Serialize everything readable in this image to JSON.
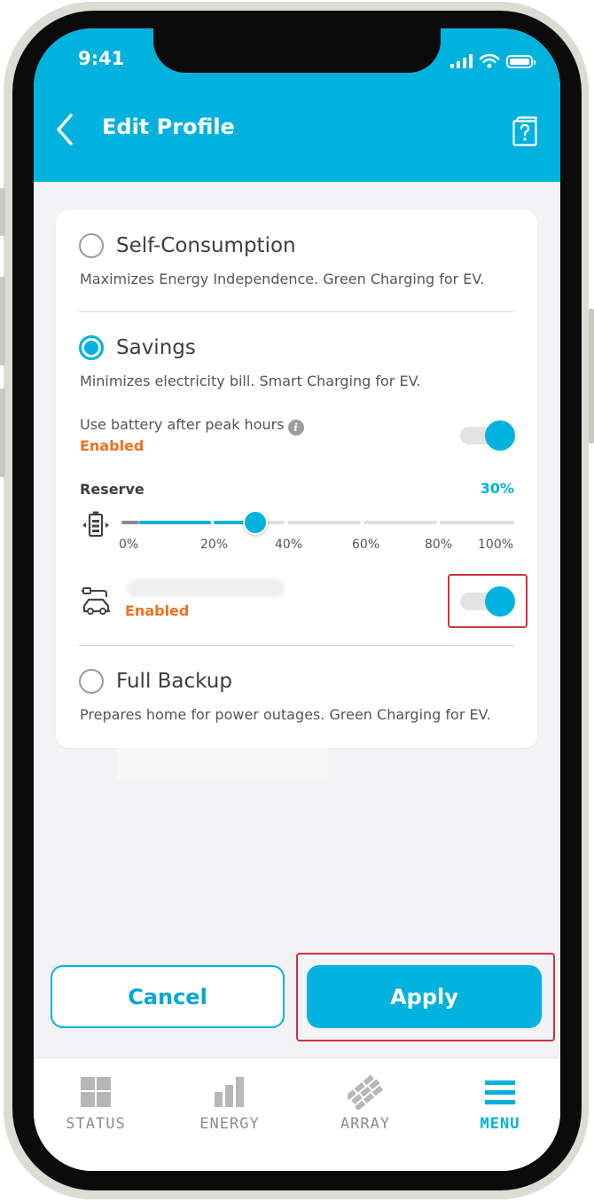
{
  "status_bar": {
    "time": "9:41"
  },
  "header": {
    "title": "Edit Profile"
  },
  "profiles": [
    {
      "title": "Self-Consumption",
      "description": "Maximizes Energy Independence. Green Charging for EV.",
      "selected": false
    },
    {
      "title": "Savings",
      "description": "Minimizes electricity bill. Smart Charging for EV.",
      "selected": true
    },
    {
      "title": "Full Backup",
      "description": "Prepares home for power outages. Green Charging for EV.",
      "selected": false
    }
  ],
  "savings_settings": {
    "battery_after_peak": {
      "label": "Use battery after peak hours",
      "info_glyph": "i",
      "status": "Enabled",
      "on": true
    },
    "reserve": {
      "label": "Reserve",
      "value": "30%",
      "level_percent": 30,
      "ticks": [
        "0%",
        "20%",
        "40%",
        "60%",
        "80%",
        "100%"
      ]
    },
    "ev_charger": {
      "status": "Enabled",
      "on": true
    }
  },
  "actions": {
    "cancel": "Cancel",
    "apply": "Apply"
  },
  "tabs": [
    {
      "label": "STATUS",
      "icon": "grid-icon",
      "active": false
    },
    {
      "label": "ENERGY",
      "icon": "bar-chart-icon",
      "active": false
    },
    {
      "label": "ARRAY",
      "icon": "solar-array-icon",
      "active": false
    },
    {
      "label": "MENU",
      "icon": "hamburger-menu-icon",
      "active": true
    }
  ],
  "colors": {
    "accent": "#00b2dd",
    "status_enabled": "#f2701e",
    "highlight": "#d0313c"
  }
}
